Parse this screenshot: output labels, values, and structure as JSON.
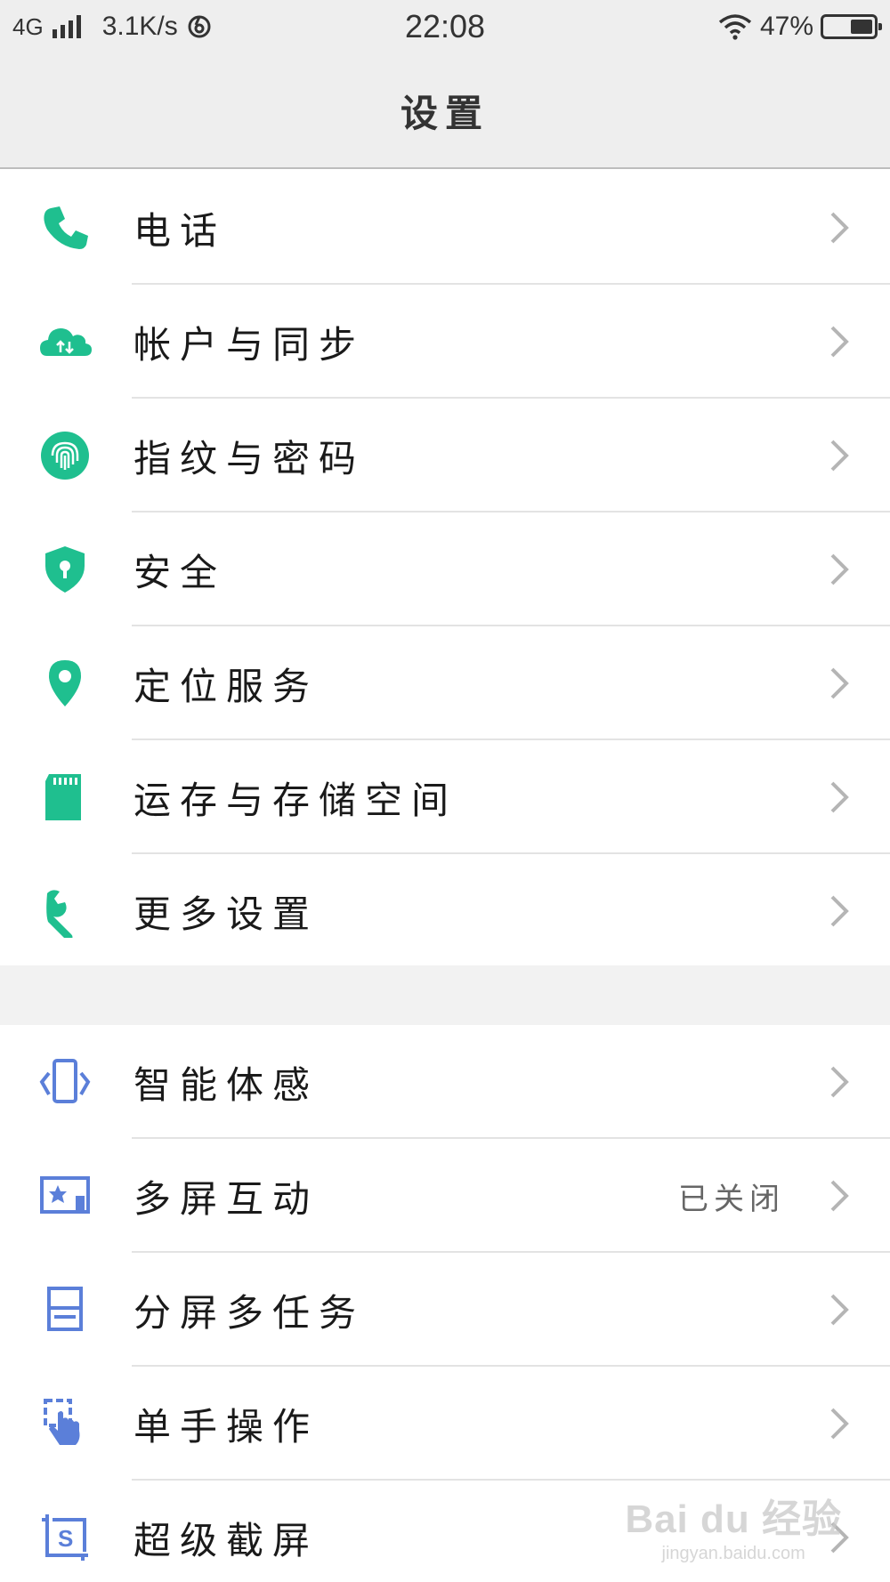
{
  "status_bar": {
    "network": "4G",
    "speed": "3.1K/s",
    "time": "22:08",
    "battery_text": "47%",
    "battery_level": 0.47
  },
  "header": {
    "title": "设置"
  },
  "colors": {
    "accent_green": "#1fbf8f",
    "accent_blue": "#5b7fd9",
    "chevron": "#b5b5b5"
  },
  "groups": [
    {
      "items": [
        {
          "label": "电话",
          "icon": "phone-icon"
        },
        {
          "label": "帐户与同步",
          "icon": "cloud-sync-icon"
        },
        {
          "label": "指纹与密码",
          "icon": "fingerprint-icon"
        },
        {
          "label": "安全",
          "icon": "shield-lock-icon"
        },
        {
          "label": "定位服务",
          "icon": "location-pin-icon"
        },
        {
          "label": "运存与存储空间",
          "icon": "sd-card-icon"
        },
        {
          "label": "更多设置",
          "icon": "wrench-icon"
        }
      ]
    },
    {
      "items": [
        {
          "label": "智能体感",
          "icon": "motion-phone-icon"
        },
        {
          "label": "多屏互动",
          "icon": "multiscreen-icon",
          "value": "已关闭"
        },
        {
          "label": "分屏多任务",
          "icon": "split-screen-icon"
        },
        {
          "label": "单手操作",
          "icon": "one-hand-icon"
        },
        {
          "label": "超级截屏",
          "icon": "screenshot-icon"
        }
      ]
    }
  ],
  "watermark": {
    "line1": "Bai du 经验",
    "line2": "jingyan.baidu.com"
  }
}
